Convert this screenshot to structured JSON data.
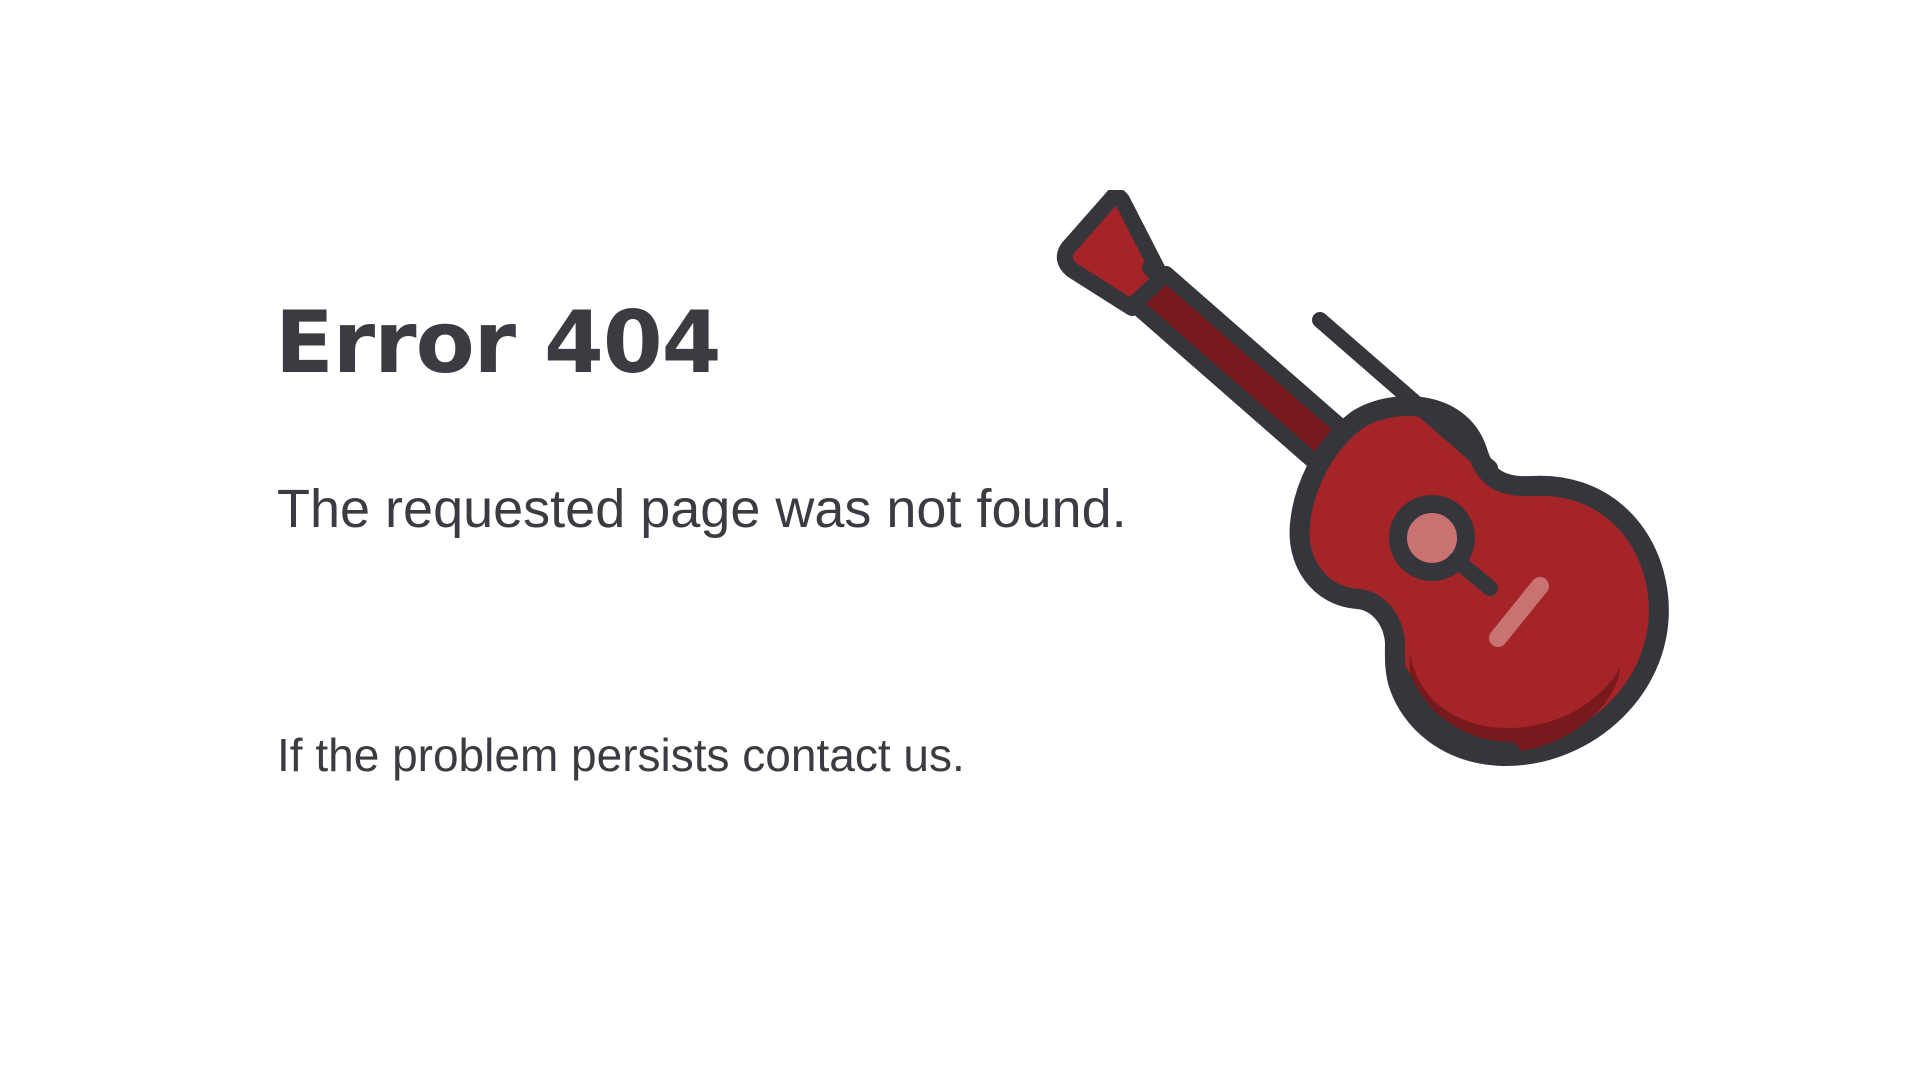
{
  "error": {
    "title": "Error 404",
    "message": "The requested page was not found.",
    "contact": "If the problem persists contact us."
  },
  "illustration": {
    "icon": "guitar-icon",
    "colors": {
      "outline": "#34363b",
      "body": "#a52428",
      "body_shadow": "#77191d",
      "highlight": "#c97272"
    }
  }
}
